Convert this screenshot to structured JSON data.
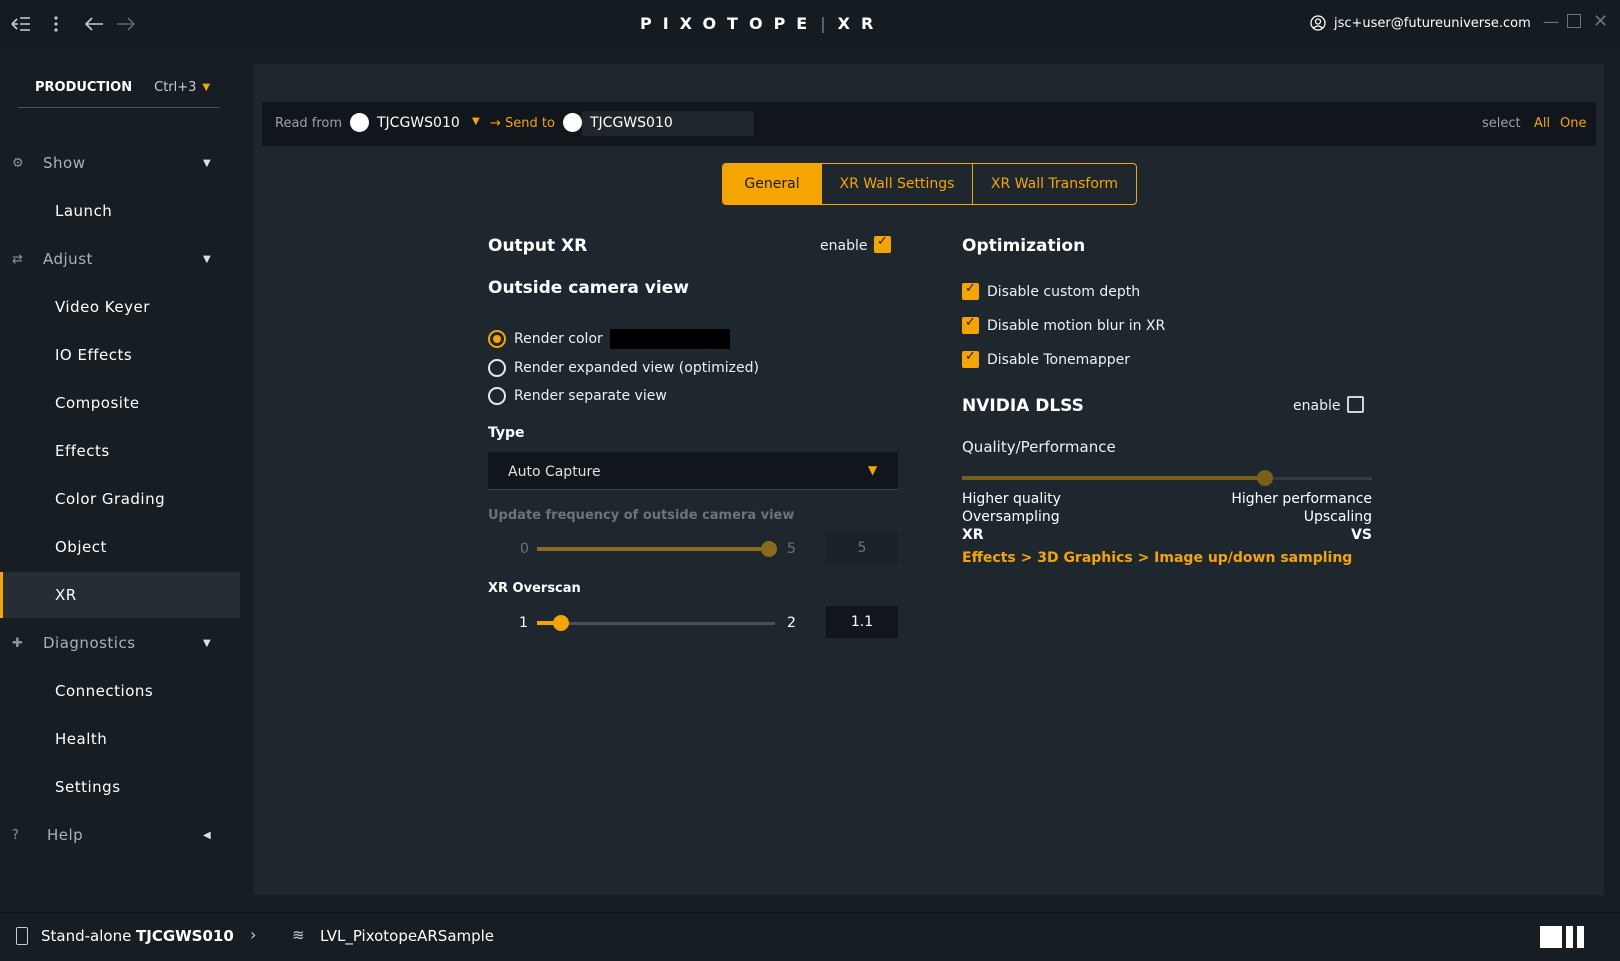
{
  "topbar": {
    "logo": "PIXOTOPE",
    "product": "XR",
    "user_email": "jsc+user@futureuniverse.com"
  },
  "sidebar": {
    "production_label": "PRODUCTION",
    "production_shortcut": "Ctrl+3",
    "sections": {
      "show": "Show",
      "adjust": "Adjust",
      "diagnostics": "Diagnostics",
      "help": "Help"
    },
    "items": {
      "launch": "Launch",
      "video_keyer": "Video Keyer",
      "io_effects": "IO Effects",
      "composite": "Composite",
      "effects": "Effects",
      "color_grading": "Color Grading",
      "object": "Object",
      "xr": "XR",
      "connections": "Connections",
      "health": "Health",
      "settings": "Settings"
    }
  },
  "subbar": {
    "read_from_label": "Read from",
    "read_from_value": "TJCGWS010",
    "send_to_label": "→ Send to",
    "send_to_value": "TJCGWS010",
    "select_label": "select",
    "select_all": "All",
    "select_one": "One"
  },
  "tabs": {
    "general": "General",
    "xr_wall_settings": "XR Wall Settings",
    "xr_wall_transform": "XR Wall Transform"
  },
  "output_xr": {
    "title": "Output XR",
    "enable_label": "enable",
    "enabled": true,
    "outside_camera_title": "Outside camera view",
    "render_color": "Render color",
    "render_expanded": "Render expanded view (optimized)",
    "render_separate": "Render separate view",
    "selected_render": "render_color",
    "type_label": "Type",
    "type_value": "Auto Capture",
    "update_freq_label": "Update frequency of outside camera view",
    "update_freq_min": "0",
    "update_freq_max": "5",
    "update_freq_value": "5",
    "update_freq_fraction": 1.0,
    "overscan_label": "XR Overscan",
    "overscan_min": "1",
    "overscan_max": "2",
    "overscan_value": "1.1",
    "overscan_fraction": 0.1
  },
  "optimization": {
    "title": "Optimization",
    "disable_custom_depth": "Disable custom depth",
    "disable_motion_blur": "Disable motion blur in XR",
    "disable_tonemapper": "Disable Tonemapper",
    "dlss_title": "NVIDIA DLSS",
    "dlss_enable_label": "enable",
    "dlss_enabled": false,
    "quality_label": "Quality/Performance",
    "quality_fraction": 0.74,
    "left_line1": "Higher quality",
    "left_line2": "Oversampling",
    "left_line3": "XR",
    "right_line1": "Higher performance",
    "right_line2": "Upscaling",
    "right_line3": "VS",
    "link": "Effects > 3D Graphics > Image up/down sampling"
  },
  "statusbar": {
    "mode": "Stand-alone",
    "machine": "TJCGWS010",
    "level": "LVL_PixotopeARSample"
  },
  "colors": {
    "accent": "#f5a500",
    "background": "#161d23",
    "panel": "#1f272e"
  }
}
